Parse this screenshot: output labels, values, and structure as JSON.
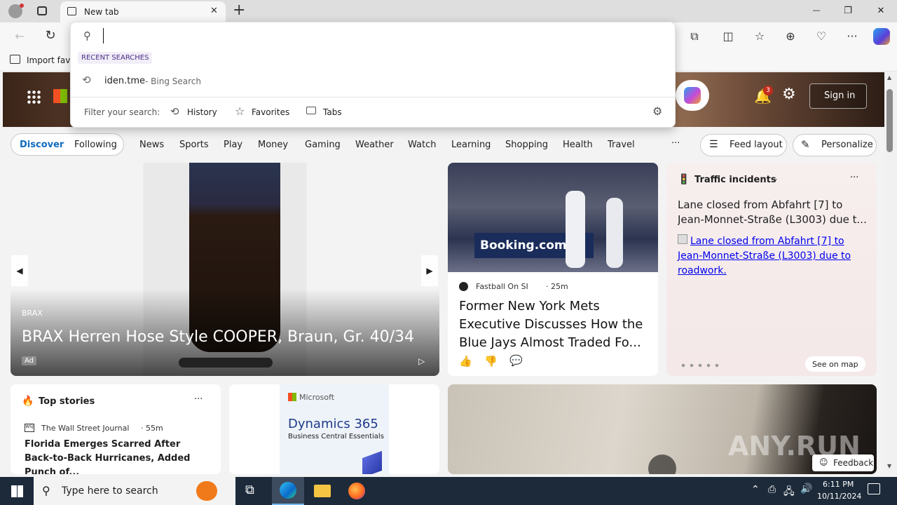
{
  "browser": {
    "tab_title": "New tab",
    "new_tab_symbol": "+",
    "window_controls": {
      "minimize": "—",
      "maximize": "❐",
      "close": "✕"
    },
    "favorites_bar_label": "Import favo",
    "omnibox": {
      "value": "",
      "section_label": "RECENT SEARCHES",
      "recent": [
        {
          "query": "iden.tme",
          "source": " - Bing Search"
        }
      ],
      "filter_label": "Filter your search:",
      "filters": [
        "History",
        "Favorites",
        "Tabs"
      ]
    }
  },
  "page": {
    "notifications_count": "3",
    "sign_in_label": "Sign in",
    "nav_pills": [
      "Discover",
      "Following"
    ],
    "nav_items": [
      "News",
      "Sports",
      "Play",
      "Money",
      "Gaming",
      "Weather",
      "Watch",
      "Learning",
      "Shopping",
      "Health",
      "Travel"
    ],
    "more_label": "···",
    "feed_layout_label": "Feed layout",
    "personalize_label": "Personalize",
    "ad_card": {
      "brand": "BRAX",
      "title": "BRAX Herren Hose Style COOPER, Braun, Gr. 40/34",
      "ad_label": "Ad"
    },
    "news_card": {
      "image_text": "Booking.com",
      "source": "Fastball On SI",
      "time": "· 25m",
      "title": "Former New York Mets Executive Discusses How the Blue Jays Almost Traded Fo..."
    },
    "traffic_card": {
      "title": "Traffic incidents",
      "headline": "Lane closed from Abfahrt [7] to Jean-Monnet-Straße (L3003) due t...",
      "link": "Lane closed from Abfahrt [7] to Jean-Monnet-Straße (L3003) due to roadwork.",
      "see_on_map": "See on map"
    },
    "top_stories": {
      "title": "Top stories",
      "source": "The Wall Street Journal",
      "time": "· 55m",
      "headline": "Florida Emerges Scarred After Back-to-Back Hurricanes, Added Punch of..."
    },
    "ms_ad": {
      "brand": "Microsoft",
      "product": "Dynamics 365",
      "subtitle": "Business Central Essentials"
    },
    "watermark": "ANY.RUN",
    "feedback_label": "Feedback"
  },
  "taskbar": {
    "search_placeholder": "Type here to search",
    "time": "6:11 PM",
    "date": "10/11/2024"
  },
  "colors": {
    "accent": "#0f6cbd",
    "taskbar": "#1c2a3a",
    "badge": "#c42b1c"
  }
}
